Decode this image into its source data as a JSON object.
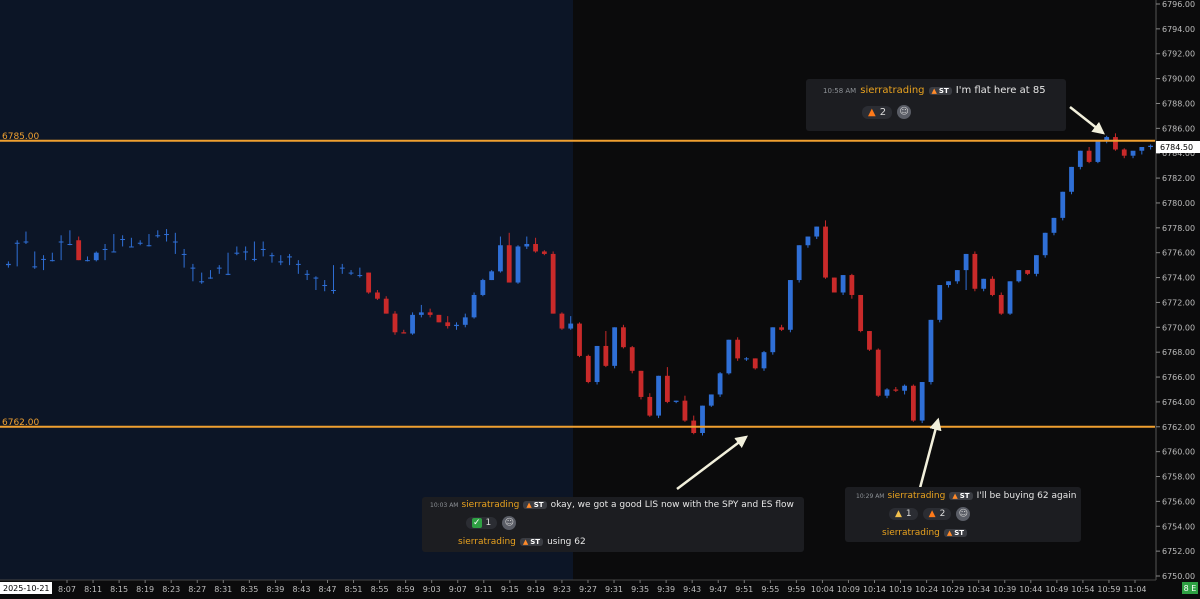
{
  "chart_data": {
    "type": "candlestick",
    "date_label": "2025-10-21",
    "x_ticks": [
      "8:07",
      "8:11",
      "8:15",
      "8:19",
      "8:23",
      "8:27",
      "8:31",
      "8:35",
      "8:39",
      "8:43",
      "8:47",
      "8:51",
      "8:55",
      "8:59",
      "9:03",
      "9:07",
      "9:11",
      "9:15",
      "9:19",
      "9:23",
      "9:27",
      "9:31",
      "9:35",
      "9:39",
      "9:43",
      "9:47",
      "9:51",
      "9:55",
      "9:59",
      "10:04",
      "10:09",
      "10:14",
      "10:19",
      "10:24",
      "10:29",
      "10:34",
      "10:39",
      "10:44",
      "10:49",
      "10:54",
      "10:59",
      "11:04"
    ],
    "y_ticks": [
      "6796.00",
      "6794.00",
      "6792.00",
      "6790.00",
      "6788.00",
      "6786.00",
      "6784.00",
      "6782.00",
      "6780.00",
      "6778.00",
      "6776.00",
      "6774.00",
      "6772.00",
      "6770.00",
      "6768.00",
      "6766.00",
      "6764.00",
      "6762.00",
      "6760.00",
      "6758.00",
      "6756.00",
      "6754.00",
      "6752.00",
      "6750.00"
    ],
    "ylim": [
      6750,
      6796
    ],
    "levels": [
      {
        "label": "6785.00",
        "value": 6785
      },
      {
        "label": "6762.00",
        "value": 6762
      }
    ],
    "last_price": "6784.50",
    "corner_label": "8 E",
    "premarket_end_time": "9:30",
    "series": {
      "open": [
        6775.0,
        6776.8,
        6776.9,
        6774.9,
        6775.5,
        6775.4,
        6776.9,
        6776.7,
        6777.0,
        6775.4,
        6775.4,
        6776.3,
        6776.1,
        6777.1,
        6776.5,
        6776.8,
        6776.6,
        6777.4,
        6777.5,
        6776.9,
        6775.9,
        6774.8,
        6773.7,
        6774.0,
        6774.8,
        6774.3,
        6776.0,
        6776.1,
        6775.5,
        6776.3,
        6775.8,
        6775.3,
        6775.7,
        6775.1,
        6774.3,
        6774.0,
        6773.4,
        6773.0,
        6774.8,
        6774.4,
        6774.2,
        6774.4,
        6772.8,
        6772.3,
        6771.1,
        6769.6,
        6769.5,
        6771.0,
        6771.2,
        6771.0,
        6770.4,
        6770.1,
        6770.2,
        6770.8,
        6772.6,
        6773.8,
        6774.5,
        6776.6,
        6773.6,
        6776.5,
        6776.7,
        6776.1,
        6775.9,
        6771.1,
        6769.9,
        6770.3,
        6767.7,
        6765.6,
        6768.5,
        6766.9,
        6770.0,
        6768.4,
        6766.5,
        6764.4,
        6762.9,
        6766.1,
        6764.0,
        6764.1,
        6762.5,
        6761.5,
        6763.7,
        6764.6,
        6766.3,
        6769.0,
        6767.5,
        6767.5,
        6766.7,
        6768.0,
        6770.0,
        6769.8,
        6773.8,
        6776.6,
        6777.3,
        6778.1,
        6774.0,
        6772.8,
        6774.2,
        6772.6,
        6769.7,
        6768.2,
        6764.5,
        6765.0,
        6764.9,
        6765.3,
        6762.5,
        6765.6,
        6770.6,
        6773.4,
        6773.7,
        6774.6,
        6775.9,
        6773.1,
        6773.9,
        6772.6,
        6771.1,
        6773.7,
        6774.6,
        6774.3,
        6775.8,
        6777.6,
        6778.8,
        6780.9,
        6782.9,
        6784.2,
        6783.3,
        6785.0,
        6785.3,
        6784.3,
        6783.8,
        6784.2,
        6784.5
      ],
      "high": [
        6775.3,
        6777.0,
        6777.7,
        6776.1,
        6775.8,
        6776.0,
        6777.4,
        6777.8,
        6777.3,
        6775.7,
        6776.1,
        6776.7,
        6777.5,
        6777.4,
        6777.2,
        6777.0,
        6777.5,
        6777.8,
        6777.9,
        6777.6,
        6776.3,
        6775.1,
        6774.4,
        6774.6,
        6775.0,
        6776.0,
        6776.5,
        6776.5,
        6776.9,
        6776.9,
        6776.0,
        6775.8,
        6775.9,
        6775.4,
        6774.6,
        6774.1,
        6773.8,
        6775.0,
        6775.1,
        6774.6,
        6774.8,
        6774.4,
        6773.0,
        6772.5,
        6771.3,
        6769.8,
        6771.2,
        6771.8,
        6771.5,
        6771.0,
        6770.9,
        6770.4,
        6771.1,
        6772.8,
        6773.9,
        6774.6,
        6777.3,
        6777.6,
        6776.6,
        6777.3,
        6777.2,
        6776.2,
        6776.1,
        6771.2,
        6770.9,
        6770.4,
        6767.8,
        6768.5,
        6769.7,
        6770.0,
        6770.2,
        6768.5,
        6766.5,
        6764.7,
        6766.1,
        6766.8,
        6764.1,
        6764.5,
        6762.9,
        6763.7,
        6764.6,
        6766.4,
        6769.0,
        6769.2,
        6767.6,
        6767.5,
        6768.1,
        6770.0,
        6770.2,
        6773.8,
        6776.6,
        6777.3,
        6778.1,
        6778.6,
        6774.0,
        6774.2,
        6774.3,
        6772.6,
        6769.7,
        6768.3,
        6765.1,
        6765.2,
        6765.4,
        6765.4,
        6765.6,
        6770.6,
        6773.4,
        6773.7,
        6774.6,
        6775.9,
        6776.1,
        6773.9,
        6774.1,
        6772.8,
        6773.7,
        6774.6,
        6774.6,
        6775.8,
        6777.6,
        6778.8,
        6780.9,
        6782.9,
        6784.2,
        6784.5,
        6785.0,
        6785.4,
        6785.6,
        6784.4,
        6783.9,
        6784.4,
        6784.7
      ],
      "low": [
        6774.8,
        6774.9,
        6776.7,
        6774.7,
        6774.6,
        6775.3,
        6775.4,
        6776.6,
        6775.4,
        6775.3,
        6775.3,
        6775.4,
        6776.1,
        6776.5,
        6776.5,
        6776.6,
        6776.5,
        6777.2,
        6776.9,
        6775.9,
        6774.8,
        6773.7,
        6773.5,
        6773.9,
        6774.3,
        6774.2,
        6775.8,
        6775.4,
        6775.3,
        6775.7,
        6775.2,
        6775.0,
        6775.0,
        6774.3,
        6773.8,
        6773.0,
        6772.9,
        6772.7,
        6774.3,
        6774.2,
        6774.0,
        6772.7,
        6772.2,
        6771.1,
        6769.4,
        6769.5,
        6769.4,
        6770.8,
        6770.8,
        6770.4,
        6769.9,
        6769.8,
        6770.0,
        6770.7,
        6772.5,
        6773.8,
        6774.4,
        6773.6,
        6773.5,
        6776.3,
        6776.0,
        6775.8,
        6771.1,
        6769.8,
        6769.8,
        6767.6,
        6765.5,
        6765.4,
        6766.8,
        6766.7,
        6768.3,
        6766.3,
        6764.2,
        6762.8,
        6762.7,
        6763.9,
        6763.9,
        6762.4,
        6761.4,
        6761.3,
        6763.6,
        6764.4,
        6766.2,
        6767.3,
        6767.3,
        6766.6,
        6766.5,
        6767.8,
        6769.7,
        6769.6,
        6773.6,
        6776.4,
        6777.1,
        6773.9,
        6772.8,
        6772.6,
        6772.3,
        6769.6,
        6768.1,
        6764.4,
        6764.3,
        6764.8,
        6764.6,
        6762.4,
        6762.3,
        6765.4,
        6770.4,
        6773.2,
        6773.5,
        6773.0,
        6772.9,
        6772.9,
        6772.5,
        6771.0,
        6771.0,
        6773.6,
        6774.2,
        6774.1,
        6775.6,
        6777.4,
        6778.6,
        6780.7,
        6782.7,
        6783.2,
        6783.2,
        6784.8,
        6784.2,
        6783.6,
        6783.6,
        6783.9,
        6784.3
      ],
      "close": [
        6775.1,
        6776.8,
        6776.9,
        6774.9,
        6775.5,
        6775.4,
        6776.9,
        6776.7,
        6775.4,
        6775.4,
        6776.0,
        6776.3,
        6776.1,
        6777.1,
        6776.5,
        6776.8,
        6776.6,
        6777.4,
        6777.5,
        6776.9,
        6775.9,
        6774.8,
        6773.7,
        6774.0,
        6774.8,
        6774.3,
        6776.0,
        6776.1,
        6775.5,
        6776.3,
        6775.8,
        6775.3,
        6775.7,
        6775.1,
        6774.3,
        6774.0,
        6773.4,
        6773.0,
        6774.8,
        6774.4,
        6774.2,
        6772.8,
        6772.3,
        6771.1,
        6769.6,
        6769.5,
        6771.0,
        6771.2,
        6771.0,
        6770.4,
        6770.1,
        6770.2,
        6770.8,
        6772.6,
        6773.8,
        6774.5,
        6776.6,
        6773.6,
        6776.5,
        6776.7,
        6776.1,
        6775.9,
        6771.1,
        6769.9,
        6770.3,
        6767.7,
        6765.6,
        6768.5,
        6766.9,
        6770.0,
        6768.4,
        6766.5,
        6764.4,
        6762.9,
        6766.1,
        6764.0,
        6764.1,
        6762.5,
        6761.5,
        6763.7,
        6764.6,
        6766.3,
        6769.0,
        6767.5,
        6767.5,
        6766.7,
        6768.0,
        6770.0,
        6769.8,
        6773.8,
        6776.6,
        6777.3,
        6778.1,
        6774.0,
        6772.8,
        6774.2,
        6772.6,
        6769.7,
        6768.2,
        6764.5,
        6765.0,
        6764.9,
        6765.3,
        6762.5,
        6765.6,
        6770.6,
        6773.4,
        6773.7,
        6774.6,
        6775.9,
        6773.1,
        6773.9,
        6772.6,
        6771.1,
        6773.7,
        6774.6,
        6774.3,
        6775.8,
        6777.6,
        6778.8,
        6780.9,
        6782.9,
        6784.2,
        6783.3,
        6785.0,
        6785.3,
        6784.3,
        6783.8,
        6784.2,
        6784.5,
        6784.6
      ]
    }
  },
  "chats": [
    {
      "time": "10:58 AM",
      "user": "sierratrading",
      "badge": "ST",
      "text": "I'm flat here at 85",
      "reactions": [
        {
          "icon": "fire-emoji",
          "count": "2"
        }
      ]
    },
    {
      "time": "10:03 AM",
      "user": "sierratrading",
      "badge": "ST",
      "text": "okay, we got a good LIS now with the SPY and ES flow",
      "reactions": [
        {
          "icon": "check-emoji",
          "count": "1"
        }
      ],
      "followup_user": "sierratrading",
      "followup_badge": "ST",
      "followup_text": "using 62"
    },
    {
      "time": "10:29 AM",
      "user": "sierratrading",
      "badge": "ST",
      "text": "I'll be buying 62 again",
      "reactions": [
        {
          "icon": "thumbs-up-emoji",
          "count": "1"
        },
        {
          "icon": "fire-emoji",
          "count": "2"
        }
      ],
      "followup_user": "sierratrading",
      "followup_badge": "ST"
    }
  ],
  "colors": {
    "up": "#2f6fd6",
    "down": "#c92a2a",
    "level": "#f0a030",
    "premarket_bg": "#0c1526",
    "rth_bg": "#0b0b0c",
    "arrow": "#f2f0dc"
  }
}
